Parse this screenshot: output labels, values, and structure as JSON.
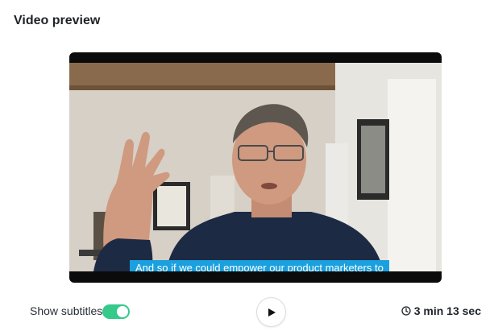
{
  "header": {
    "title": "Video preview"
  },
  "video": {
    "subtitle_text": "And so if we could empower our product marketers to"
  },
  "controls": {
    "show_subtitles_label": "Show subtitles",
    "subtitles_enabled": true,
    "play_icon": "play-icon",
    "clock_icon": "clock-icon",
    "duration": "3 min 13 sec"
  },
  "colors": {
    "toggle_on": "#35c98a",
    "subtitle_bg": "#1aa0de",
    "player_bg": "#0b0b0b"
  }
}
